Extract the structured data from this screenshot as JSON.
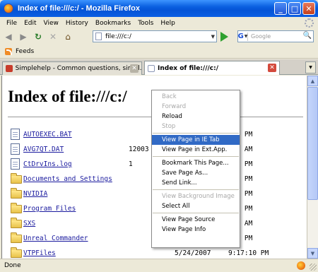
{
  "window": {
    "title": "Index of file:///c:/ - Mozilla Firefox",
    "minimize": "_",
    "maximize": "□",
    "close": "✕"
  },
  "menu": [
    "File",
    "Edit",
    "View",
    "History",
    "Bookmarks",
    "Tools",
    "Help"
  ],
  "nav": {
    "back_glyph": "◀",
    "forward_glyph": "▶",
    "reload_glyph": "↻",
    "stop_glyph": "✕",
    "home_glyph": "⌂",
    "url": "file:///c:/",
    "search_engine_letter": "G",
    "search_placeholder": "Google",
    "search_glyph": "🔍"
  },
  "bookmarks": {
    "feeds_label": "Feeds"
  },
  "tabs": [
    {
      "label": "Simplehelp - Common questions, simpl...",
      "active": false
    },
    {
      "label": "Index of file:///c:/",
      "active": true
    }
  ],
  "page": {
    "title": "Index of file:///c:/",
    "entries": [
      {
        "type": "file",
        "name": "AUTOEXEC.BAT",
        "size": "",
        "date": "",
        "time": ":38 PM"
      },
      {
        "type": "file",
        "name": "AVG7QT.DAT",
        "size": "12003",
        "date": "",
        "time": ":05 AM"
      },
      {
        "type": "file",
        "name": "CtDrvIns.log",
        "size": "1",
        "date": "",
        "time": ":31 PM"
      },
      {
        "type": "folder",
        "name": "Documents and Settings",
        "size": "",
        "date": "",
        "time": ":48 PM"
      },
      {
        "type": "folder",
        "name": "NVIDIA",
        "size": "",
        "date": "",
        "time": ":48 PM"
      },
      {
        "type": "folder",
        "name": "Program Files",
        "size": "",
        "date": "",
        "time": ":16 PM"
      },
      {
        "type": "folder",
        "name": "SXS",
        "size": "",
        "date": "",
        "time": ":36 AM"
      },
      {
        "type": "folder",
        "name": "Unreal Commander",
        "size": "",
        "date": "",
        "time": ":48 PM"
      },
      {
        "type": "folder",
        "name": "VTPFiles",
        "size": "",
        "date": "5/24/2007",
        "time": "9:17:10 PM"
      }
    ]
  },
  "context_menu": {
    "items": [
      {
        "label": "Back",
        "state": "disabled"
      },
      {
        "label": "Forward",
        "state": "disabled"
      },
      {
        "label": "Reload",
        "state": "normal"
      },
      {
        "label": "Stop",
        "state": "disabled"
      },
      {
        "sep": true
      },
      {
        "label": "View Page in IE Tab",
        "state": "selected"
      },
      {
        "label": "View Page in Ext.App.",
        "state": "normal"
      },
      {
        "sep": true
      },
      {
        "label": "Bookmark This Page...",
        "state": "normal"
      },
      {
        "label": "Save Page As...",
        "state": "normal"
      },
      {
        "label": "Send Link...",
        "state": "normal"
      },
      {
        "sep": true
      },
      {
        "label": "View Background Image",
        "state": "disabled"
      },
      {
        "label": "Select All",
        "state": "normal"
      },
      {
        "sep": true
      },
      {
        "label": "View Page Source",
        "state": "normal"
      },
      {
        "label": "View Page Info",
        "state": "normal"
      }
    ]
  },
  "status": {
    "text": "Done"
  }
}
